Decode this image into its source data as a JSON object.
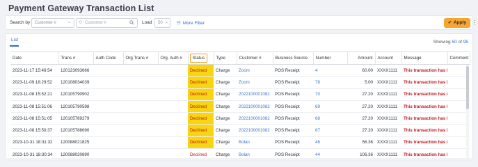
{
  "page_title": "Payment Gateway Transaction List",
  "filter": {
    "search_by_label": "Search by",
    "search_by_value": "Customer #",
    "search_placeholder": "Customer #",
    "load_label": "Load",
    "load_value": "50",
    "more_filter_label": "More Filter",
    "apply_label": "Apply"
  },
  "list": {
    "tab_label": "List",
    "showing_prefix": "Showing",
    "showing_count": "50",
    "showing_of": "of",
    "showing_total": "95"
  },
  "table": {
    "columns": [
      "Date",
      "Trans #",
      "Auth Code",
      "Org Trans #",
      "Org. Auth #",
      "Status",
      "Type",
      "Customer #",
      "Business Source",
      "Number",
      "Amount",
      "Account",
      "Message",
      "Comment"
    ],
    "rows": [
      {
        "date": "2023-11-17 15:46:54",
        "trans": "120123093666",
        "auth": "",
        "org_trans": "",
        "org_auth": "",
        "status": "Declined",
        "type": "Charge",
        "customer": "Zoom",
        "source": "POS Receipt",
        "number": "4",
        "amount": "60.00",
        "account": "XXXX1111",
        "message": "This transaction has b",
        "comment": ""
      },
      {
        "date": "2023-11-09 18:29:52",
        "trans": "120108034039",
        "auth": "",
        "org_trans": "",
        "org_auth": "",
        "status": "Declined",
        "type": "Charge",
        "customer": "Zoom",
        "source": "POS Receipt",
        "number": "78",
        "amount": "5.00",
        "account": "XXXX1111",
        "message": "This transaction has b",
        "comment": ""
      },
      {
        "date": "2023-11-08 15:52:21",
        "trans": "120105790902",
        "auth": "",
        "org_trans": "",
        "org_auth": "",
        "status": "Declined",
        "type": "Charge",
        "customer": "2022100001082",
        "source": "POS Receipt",
        "number": "70",
        "amount": "27.20",
        "account": "XXXX1111",
        "message": "This transaction has b",
        "comment": ""
      },
      {
        "date": "2023-11-08 15:51:06",
        "trans": "120105790598",
        "auth": "",
        "org_trans": "",
        "org_auth": "",
        "status": "Declined",
        "type": "Charge",
        "customer": "2022100001082",
        "source": "POS Receipt",
        "number": "69",
        "amount": "27.20",
        "account": "XXXX1111",
        "message": "This transaction has b",
        "comment": ""
      },
      {
        "date": "2023-11-08 15:51:05",
        "trans": "120105789279",
        "auth": "",
        "org_trans": "",
        "org_auth": "",
        "status": "Declined",
        "type": "Charge",
        "customer": "2022100001082",
        "source": "POS Receipt",
        "number": "68",
        "amount": "27.20",
        "account": "XXXX1111",
        "message": "This transaction has b",
        "comment": ""
      },
      {
        "date": "2023-11-08 15:50:37",
        "trans": "120105788690",
        "auth": "",
        "org_trans": "",
        "org_auth": "",
        "status": "Declined",
        "type": "Charge",
        "customer": "2022100001082",
        "source": "POS Receipt",
        "number": "67",
        "amount": "27.20",
        "account": "XXXX1111",
        "message": "This transaction has b",
        "comment": ""
      },
      {
        "date": "2023-10-31 18:31:32",
        "trans": "120088021825",
        "auth": "",
        "org_trans": "",
        "org_auth": "",
        "status": "Declined",
        "type": "Charge",
        "customer": "Bolan",
        "source": "POS Receipt",
        "number": "46",
        "amount": "56.36",
        "account": "XXXX1111",
        "message": "This transaction has b",
        "comment": ""
      },
      {
        "date": "2023-10-31 18:30:34",
        "trans": "120088020890",
        "auth": "",
        "org_trans": "",
        "org_auth": "",
        "status": "Declined",
        "type": "Charge",
        "customer": "Bolan",
        "source": "POS Receipt",
        "number": "44",
        "amount": "106.36",
        "account": "XXXX1111",
        "message": "This transaction has b",
        "comment": ""
      }
    ],
    "highlighted_status_rows": 7
  },
  "colors": {
    "accent": "#2e6bd6",
    "apply": "#f7a531",
    "status_highlight": "#f7d511",
    "declined": "#c4181f"
  },
  "icons": {
    "funnel": "funnel-icon",
    "search": "search-icon",
    "more_filter": "sliders-icon",
    "apply": "check-icon",
    "kebab": "kebab-menu-icon"
  }
}
